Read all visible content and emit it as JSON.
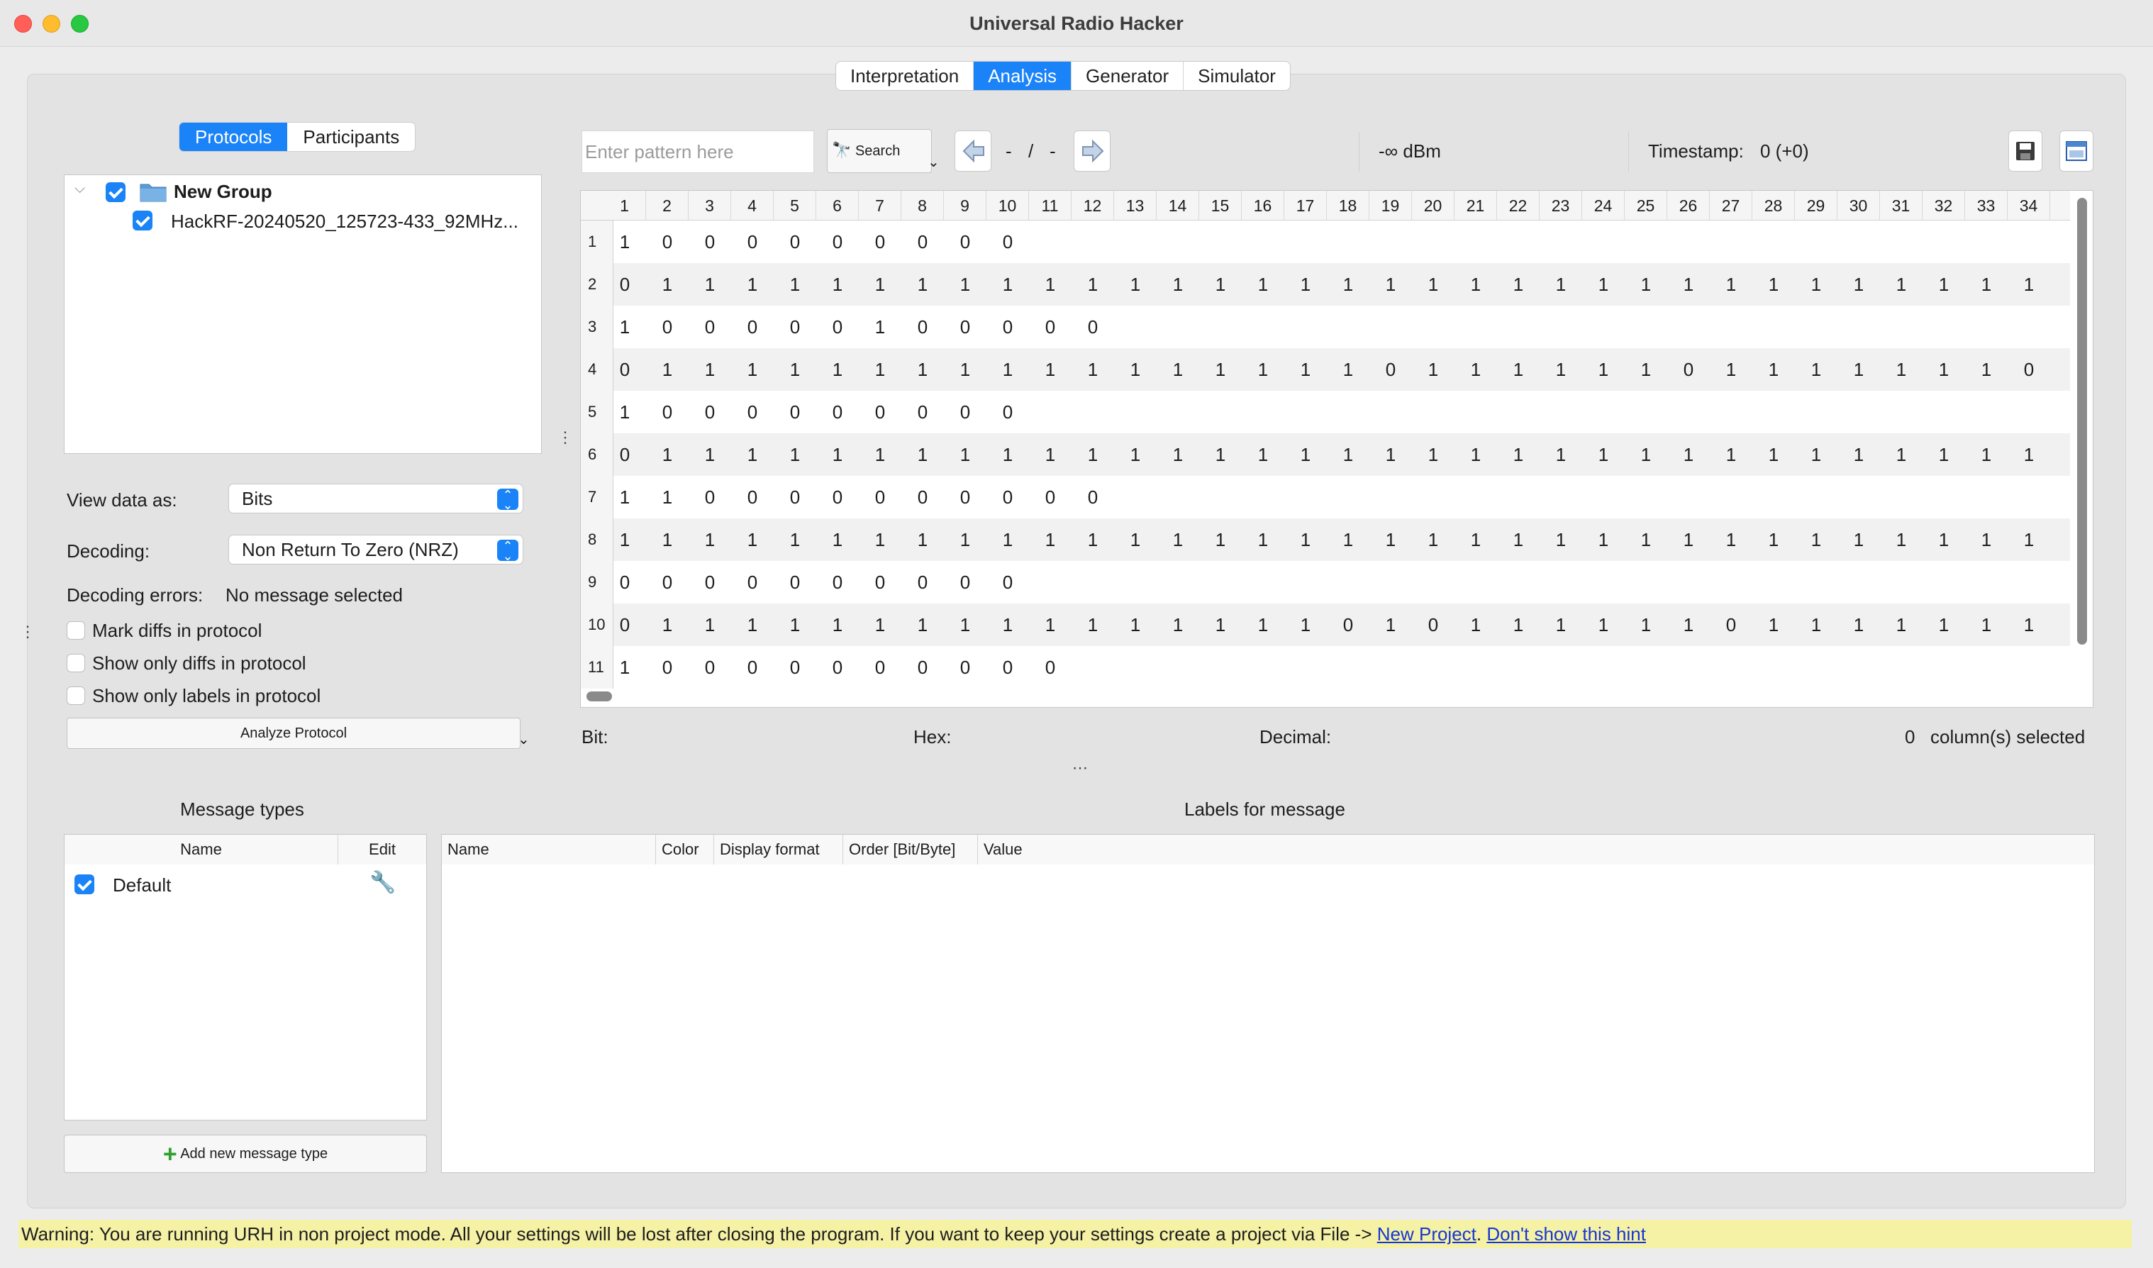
{
  "window": {
    "title": "Universal Radio Hacker"
  },
  "tabs": [
    "Interpretation",
    "Analysis",
    "Generator",
    "Simulator"
  ],
  "active_tab": "Analysis",
  "left": {
    "segments": [
      "Protocols",
      "Participants"
    ],
    "active_segment": "Protocols",
    "tree": {
      "group": "New Group",
      "file": "HackRF-20240520_125723-433_92MHz..."
    },
    "view_data_label": "View data as:",
    "view_data_value": "Bits",
    "decoding_label": "Decoding:",
    "decoding_value": "Non Return To Zero (NRZ)",
    "decoding_errors_label": "Decoding errors:",
    "decoding_errors_value": "No message selected",
    "options": [
      "Mark diffs in protocol",
      "Show only diffs in protocol",
      "Show only labels in protocol"
    ],
    "analyze_button": "Analyze Protocol"
  },
  "toolbar": {
    "search_placeholder": "Enter pattern here",
    "search_button": "Search",
    "search_pos_a": "-",
    "search_sep": "/",
    "search_pos_b": "-",
    "rssi": "-∞ dBm",
    "timestamp_label": "Timestamp:",
    "timestamp_value": "0 (+0)"
  },
  "table": {
    "columns": [
      "1",
      "2",
      "3",
      "4",
      "5",
      "6",
      "7",
      "8",
      "9",
      "10",
      "11",
      "12",
      "13",
      "14",
      "15",
      "16",
      "17",
      "18",
      "19",
      "20",
      "21",
      "22",
      "23",
      "24",
      "25",
      "26",
      "27",
      "28",
      "29",
      "30",
      "31",
      "32",
      "33",
      "34"
    ],
    "rows": [
      [
        "1",
        "0",
        "0",
        "0",
        "0",
        "0",
        "0",
        "0",
        "0",
        "0"
      ],
      [
        "0",
        "1",
        "1",
        "1",
        "1",
        "1",
        "1",
        "1",
        "1",
        "1",
        "1",
        "1",
        "1",
        "1",
        "1",
        "1",
        "1",
        "1",
        "1",
        "1",
        "1",
        "1",
        "1",
        "1",
        "1",
        "1",
        "1",
        "1",
        "1",
        "1",
        "1",
        "1",
        "1",
        "1"
      ],
      [
        "1",
        "0",
        "0",
        "0",
        "0",
        "0",
        "1",
        "0",
        "0",
        "0",
        "0",
        "0"
      ],
      [
        "0",
        "1",
        "1",
        "1",
        "1",
        "1",
        "1",
        "1",
        "1",
        "1",
        "1",
        "1",
        "1",
        "1",
        "1",
        "1",
        "1",
        "1",
        "0",
        "1",
        "1",
        "1",
        "1",
        "1",
        "1",
        "0",
        "1",
        "1",
        "1",
        "1",
        "1",
        "1",
        "1",
        "0"
      ],
      [
        "1",
        "0",
        "0",
        "0",
        "0",
        "0",
        "0",
        "0",
        "0",
        "0"
      ],
      [
        "0",
        "1",
        "1",
        "1",
        "1",
        "1",
        "1",
        "1",
        "1",
        "1",
        "1",
        "1",
        "1",
        "1",
        "1",
        "1",
        "1",
        "1",
        "1",
        "1",
        "1",
        "1",
        "1",
        "1",
        "1",
        "1",
        "1",
        "1",
        "1",
        "1",
        "1",
        "1",
        "1",
        "1"
      ],
      [
        "1",
        "1",
        "0",
        "0",
        "0",
        "0",
        "0",
        "0",
        "0",
        "0",
        "0",
        "0"
      ],
      [
        "1",
        "1",
        "1",
        "1",
        "1",
        "1",
        "1",
        "1",
        "1",
        "1",
        "1",
        "1",
        "1",
        "1",
        "1",
        "1",
        "1",
        "1",
        "1",
        "1",
        "1",
        "1",
        "1",
        "1",
        "1",
        "1",
        "1",
        "1",
        "1",
        "1",
        "1",
        "1",
        "1",
        "1"
      ],
      [
        "0",
        "0",
        "0",
        "0",
        "0",
        "0",
        "0",
        "0",
        "0",
        "0"
      ],
      [
        "0",
        "1",
        "1",
        "1",
        "1",
        "1",
        "1",
        "1",
        "1",
        "1",
        "1",
        "1",
        "1",
        "1",
        "1",
        "1",
        "1",
        "0",
        "1",
        "0",
        "1",
        "1",
        "1",
        "1",
        "1",
        "1",
        "0",
        "1",
        "1",
        "1",
        "1",
        "1",
        "1",
        "1"
      ],
      [
        "1",
        "0",
        "0",
        "0",
        "0",
        "0",
        "0",
        "0",
        "0",
        "0",
        "0"
      ]
    ]
  },
  "status": {
    "bit_label": "Bit:",
    "hex_label": "Hex:",
    "decimal_label": "Decimal:",
    "selected_count": "0",
    "selected_label": "column(s) selected"
  },
  "message_types": {
    "title": "Message types",
    "col_name": "Name",
    "col_edit": "Edit",
    "items": [
      "Default"
    ],
    "add_button": "Add new message type"
  },
  "labels": {
    "title": "Labels for message",
    "columns": [
      "Name",
      "Color",
      "Display format",
      "Order [Bit/Byte]",
      "Value"
    ]
  },
  "warning": {
    "text": "Warning: You are running URH in non project mode. All your settings will be lost after closing the program. If you want to keep your settings create a project via File -> ",
    "link1": "New Project",
    "sep": ". ",
    "link2": "Don't show this hint"
  },
  "colors": {
    "accent": "#1a83f7",
    "warning_bg": "#f5f1a5",
    "link": "#1536d6"
  }
}
